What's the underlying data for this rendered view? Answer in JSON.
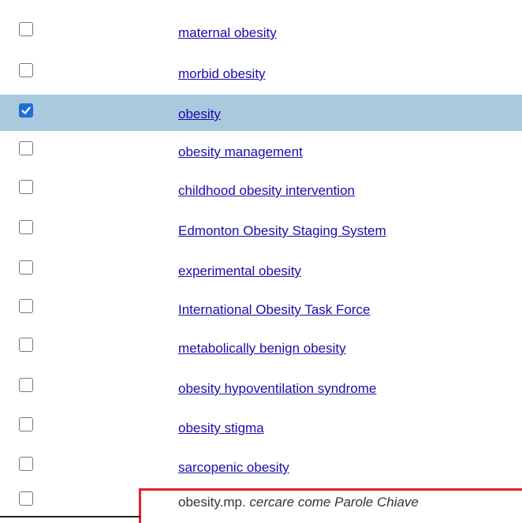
{
  "colors": {
    "link": "#1a0dab",
    "selected_row_bg": "#a9c9de",
    "checkbox_checked": "#1f6fd6",
    "highlight_border": "#e0202a"
  },
  "terms": [
    {
      "label": "maternal obesity",
      "checked": false
    },
    {
      "label": "morbid obesity",
      "checked": false
    },
    {
      "label": "obesity",
      "checked": true
    },
    {
      "label": "obesity management",
      "checked": false
    },
    {
      "label": "childhood obesity intervention",
      "checked": false
    },
    {
      "label": "Edmonton Obesity Staging System",
      "checked": false
    },
    {
      "label": "experimental obesity",
      "checked": false
    },
    {
      "label": "International Obesity Task Force",
      "checked": false
    },
    {
      "label": "metabolically benign obesity",
      "checked": false
    },
    {
      "label": "obesity hypoventilation syndrome",
      "checked": false
    },
    {
      "label": "obesity stigma",
      "checked": false
    },
    {
      "label": "sarcopenic obesity",
      "checked": false
    }
  ],
  "keyword_row": {
    "term": "obesity.mp.",
    "hint": "cercare come Parole Chiave",
    "checked": false
  }
}
